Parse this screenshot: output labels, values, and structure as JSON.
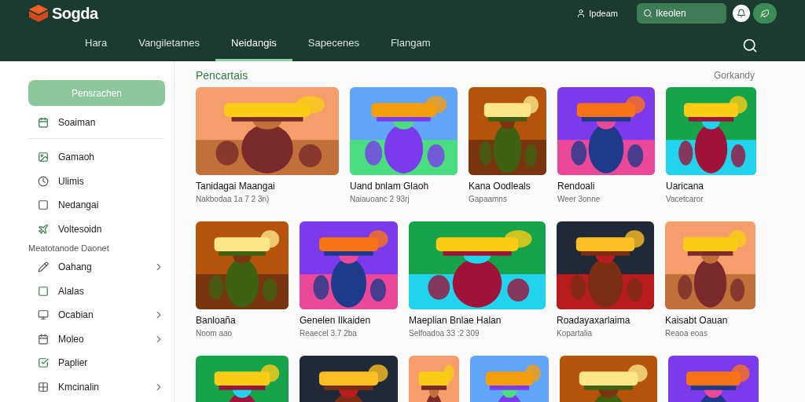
{
  "header": {
    "logo": "Sogda",
    "user": "Ipdeam",
    "search": {
      "placeholder": "Ikeolen"
    }
  },
  "tabs": [
    {
      "label": "Hara",
      "selected": false
    },
    {
      "label": "Vangiletames",
      "selected": false
    },
    {
      "label": "Neidangis",
      "selected": true
    },
    {
      "label": "Sapecenes",
      "selected": false
    },
    {
      "label": "Flangam",
      "selected": false
    }
  ],
  "sidebar": {
    "button": "Pensrachen",
    "top_item": "Soaiman",
    "items": [
      {
        "label": "Gamaoh",
        "kind": "item",
        "expandable": false
      },
      {
        "label": "Ulimis",
        "kind": "item",
        "expandable": false
      },
      {
        "label": "Nedangai",
        "kind": "item",
        "expandable": false
      },
      {
        "label": "Voltesoidn",
        "kind": "item",
        "expandable": false
      },
      {
        "label": "Meatotanode Daonet",
        "kind": "heading"
      },
      {
        "label": "Oahang",
        "kind": "item",
        "expandable": true
      },
      {
        "label": "Alalas",
        "kind": "item",
        "expandable": false
      },
      {
        "label": "Ocabian",
        "kind": "item",
        "expandable": true
      },
      {
        "label": "Moleo",
        "kind": "item",
        "expandable": true
      },
      {
        "label": "Paplier",
        "kind": "item",
        "expandable": false
      },
      {
        "label": "Kmcinalin",
        "kind": "item",
        "expandable": true
      }
    ]
  },
  "section": {
    "title": "Pencartais",
    "link": "Gorkandy"
  },
  "rows": [
    {
      "cards": [
        {
          "title": "Tanidagai Maangai",
          "subtitle": "Nakbodaa 1a 7 2 3n)"
        },
        {
          "title": "Uand bnlam Glaoh",
          "subtitle": "Naiauoanc 2 93rj"
        },
        {
          "title": "Kana Oodleals",
          "subtitle": "Gapaamns"
        },
        {
          "title": "Rendoali",
          "subtitle": "Weer 3onne"
        },
        {
          "title": "Uaricana",
          "subtitle": "Vacetcaror"
        }
      ]
    },
    {
      "cards": [
        {
          "title": "Banloaña",
          "subtitle": "Noom aao"
        },
        {
          "title": "Genelen Ilkaiden",
          "subtitle": "Reaecel 3.7 2ba"
        },
        {
          "title": "Maeplian Bnlae Halan",
          "subtitle": "Selfoadoa 33 :2 309"
        },
        {
          "title": "Roadayaxarlaima",
          "subtitle": "Kopartalia"
        },
        {
          "title": "Kaisabt Oauan",
          "subtitle": "Reaoa eoas"
        }
      ]
    }
  ]
}
